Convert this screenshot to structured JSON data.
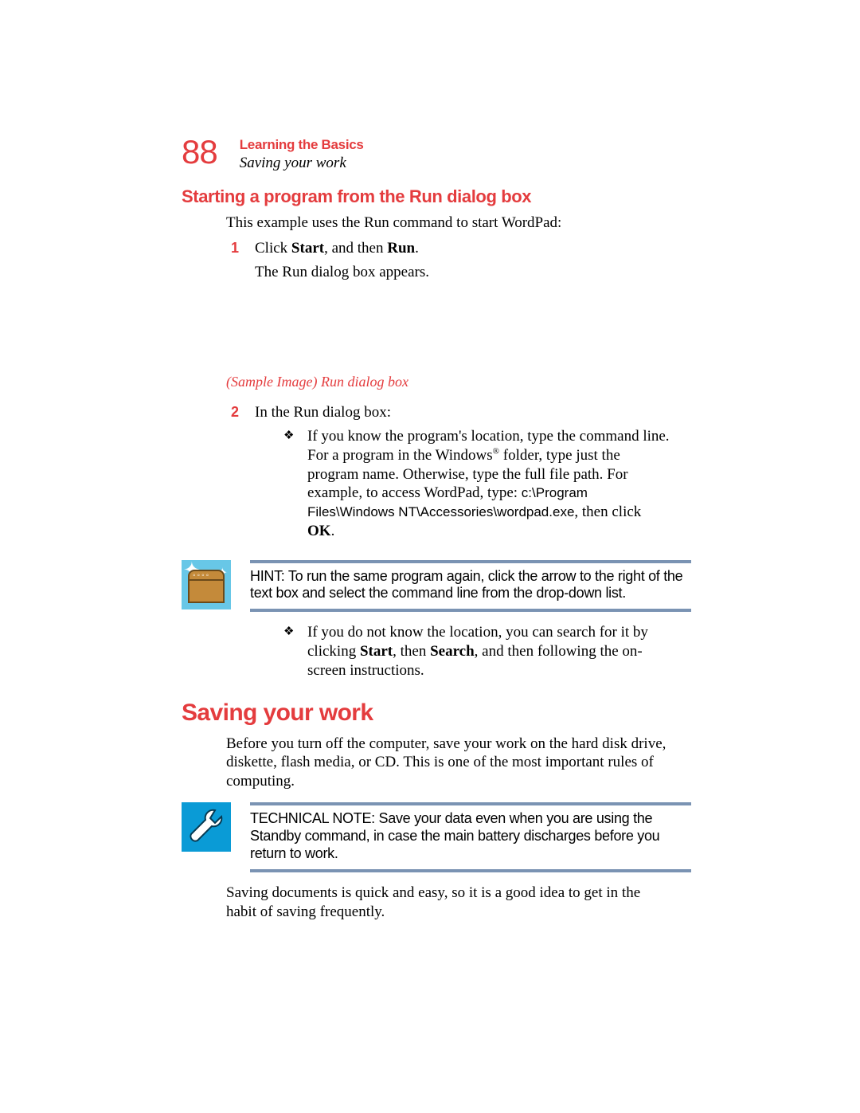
{
  "header": {
    "page_number": "88",
    "chapter": "Learning the Basics",
    "section": "Saving your work"
  },
  "section1": {
    "heading": "Starting a program from the Run dialog box",
    "intro": "This example uses the Run command to start WordPad:",
    "step1_num": "1",
    "step1_a": "Click ",
    "step1_b": "Start",
    "step1_c": ", and then ",
    "step1_d": "Run",
    "step1_e": ".",
    "step1_result": "The Run dialog box appears.",
    "caption": "(Sample Image) Run dialog box",
    "step2_num": "2",
    "step2_intro": "In the Run dialog box:",
    "bullet1_a": "If you know the program's location, type the command line. For a program in the Windows",
    "bullet1_reg": "®",
    "bullet1_b": " folder, type just the program name. Otherwise, type the full file path. For example, to access WordPad, type: ",
    "bullet1_path": "c:\\Program Files\\Windows NT\\Accessories\\wordpad.exe",
    "bullet1_c": ", then click ",
    "bullet1_d": "OK",
    "bullet1_e": ".",
    "hint": "HINT: To run the same program again, click the arrow to the right of the text box and select the command line from the drop-down list.",
    "bullet2_a": "If you do not know the location, you can search for it by clicking ",
    "bullet2_b": "Start",
    "bullet2_c": ", then ",
    "bullet2_d": "Search",
    "bullet2_e": ", and then following the on-screen instructions."
  },
  "section2": {
    "heading": "Saving your work",
    "para1": "Before you turn off the computer, save your work on the hard disk drive, diskette, flash media, or CD. This is one of the most important rules of computing.",
    "technote": "TECHNICAL NOTE: Save your data even when you are using the Standby command, in case the main battery discharges before you return to work.",
    "para2": "Saving documents is quick and easy, so it is a good idea to get in the habit of saving frequently."
  }
}
